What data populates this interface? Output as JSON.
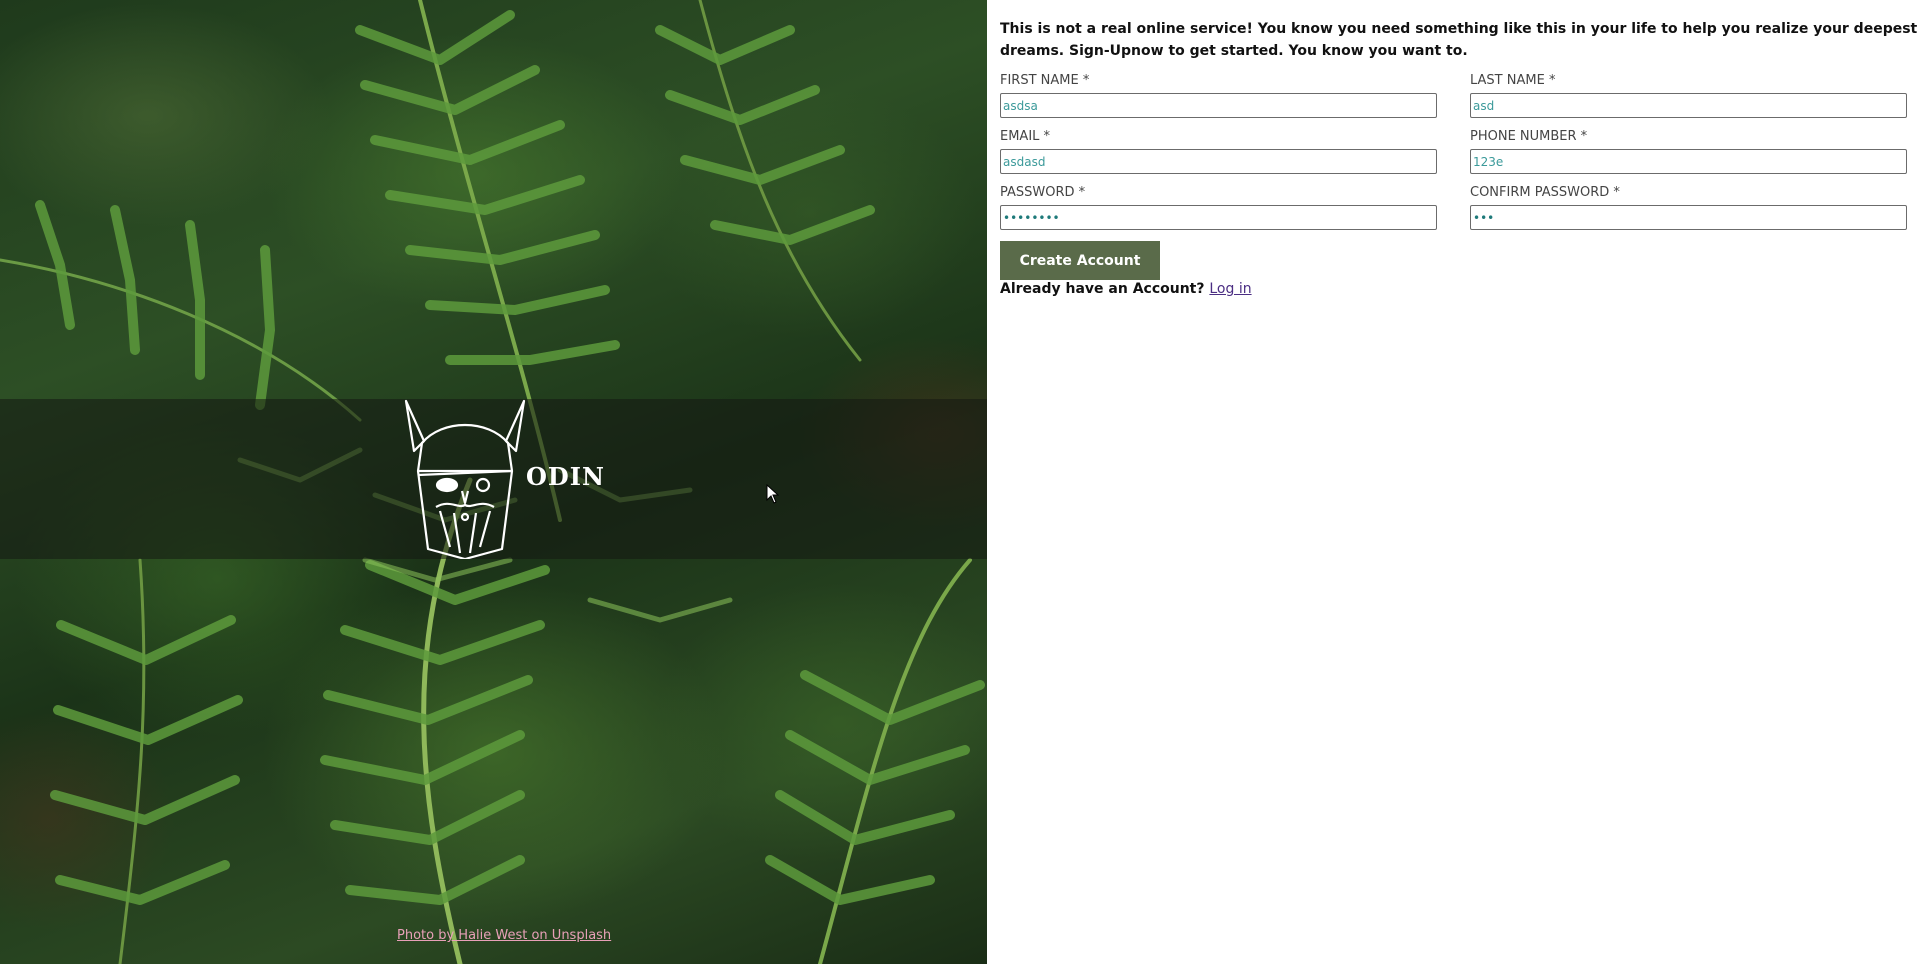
{
  "hero": {
    "brand": "ODIN",
    "photo_credit": "Photo by Halie West on Unsplash",
    "logo_icon": "odin-viking-helmet-icon",
    "colors": {
      "overlay": "#14181280",
      "credit_link": "#e8a0b8"
    }
  },
  "form": {
    "intro": "This is not a real online service! You know you need something like this in your life to help you realize your deepest dreams. Sign-Upnow to get started. You know you want to.",
    "fields": {
      "first_name": {
        "label": "FIRST NAME *",
        "value": "asdsa"
      },
      "last_name": {
        "label": "LAST NAME *",
        "value": "asd"
      },
      "email": {
        "label": "EMAIL *",
        "value": "asdasd"
      },
      "phone": {
        "label": "PHONE NUMBER *",
        "value": "123e"
      },
      "password": {
        "label": "PASSWORD *",
        "value": "••••••••"
      },
      "confirm_password": {
        "label": "CONFIRM PASSWORD *",
        "value": "•••"
      }
    },
    "submit_label": "Create Account",
    "login_prompt": "Already have an Account?",
    "login_link": "Log in",
    "colors": {
      "button_bg": "#5a6b4a",
      "input_text": "#3b9a9a",
      "link": "#4b2e83"
    }
  }
}
